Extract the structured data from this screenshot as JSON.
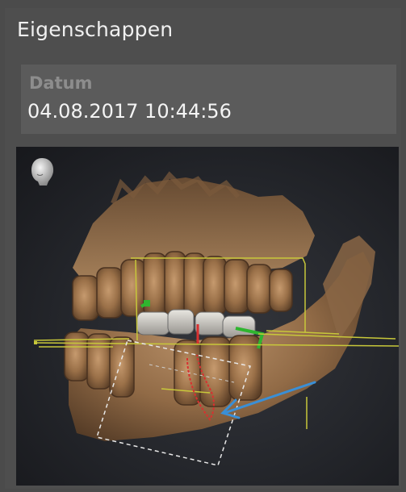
{
  "panel": {
    "title": "Eigenschappen",
    "date_label": "Datum",
    "date_value": "04.08.2017 10:44:56"
  },
  "viewer": {
    "orientation_icon": "head-orientation-icon",
    "content": "3D dental volume rendering"
  },
  "colors": {
    "panel_bg": "#4e4e4e",
    "field_bg": "#5b5b5b",
    "bone": "#a07650",
    "guide_yellow": "#c8c83a",
    "arrow_blue": "#3a8fd6",
    "nerve_red": "#d83030"
  }
}
